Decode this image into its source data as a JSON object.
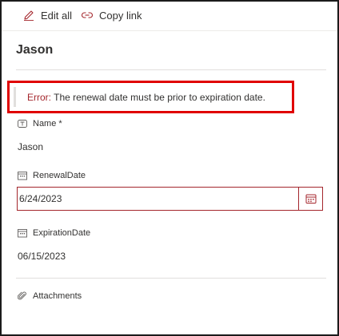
{
  "toolbar": {
    "edit_all_label": "Edit all",
    "copy_link_label": "Copy link"
  },
  "item": {
    "title": "Jason"
  },
  "error": {
    "label": "Error:",
    "message": " The renewal date must be prior to expiration date."
  },
  "fields": {
    "name": {
      "label": "Name *",
      "value": "Jason",
      "icon": "text-field-icon"
    },
    "renewal_date": {
      "label": "RenewalDate",
      "value": "6/24/2023",
      "icon": "calendar-icon"
    },
    "expiration_date": {
      "label": "ExpirationDate",
      "value": "06/15/2023",
      "icon": "calendar-icon"
    },
    "attachments": {
      "label": "Attachments",
      "icon": "paperclip-icon"
    }
  },
  "colors": {
    "error_text": "#a4262c",
    "highlight_box": "#e00000",
    "input_error_border": "#a4262c"
  }
}
